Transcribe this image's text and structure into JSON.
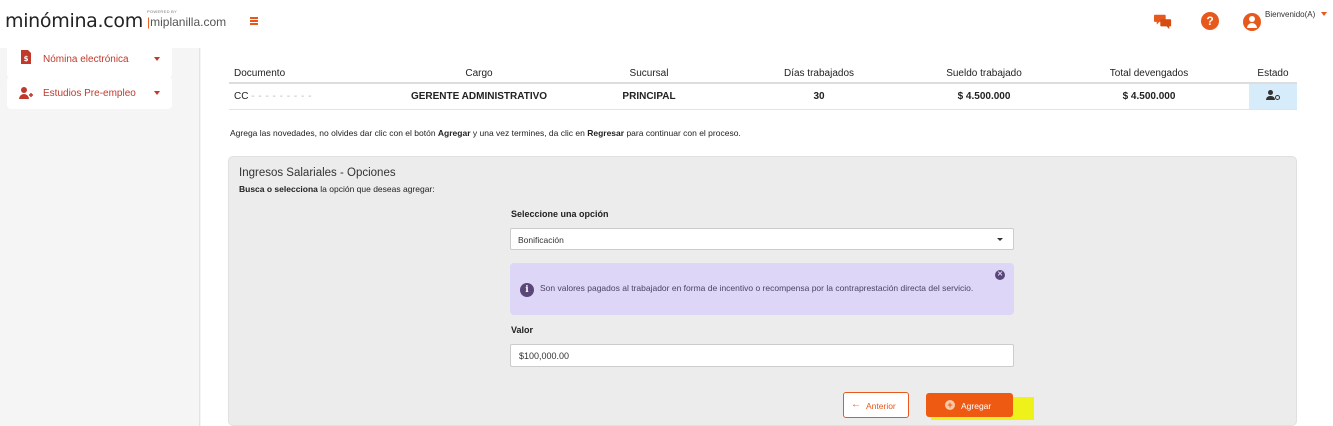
{
  "header": {
    "logo_text": "minómina.com",
    "powered_by": "POWERED BY",
    "sublogo": "miplanilla.com",
    "welcome": "Bienvenido(A)",
    "help_glyph": "?",
    "icons": [
      "menu-toggle-icon",
      "chat-icon",
      "help-icon",
      "user-icon"
    ],
    "accent_color": "#e8581c"
  },
  "sidebar": {
    "items": [
      {
        "label": "Nómina electrónica",
        "icon": "file-dollar-icon"
      },
      {
        "label": "Estudios Pre-empleo",
        "icon": "user-plus-icon"
      }
    ]
  },
  "table": {
    "headers": [
      "Documento",
      "Cargo",
      "Sucursal",
      "Días trabajados",
      "Sueldo trabajado",
      "Total devengados",
      "Estado"
    ],
    "row": {
      "documento_prefix": "CC",
      "documento_masked": "- - - - - - - - -",
      "cargo": "GERENTE ADMINISTRATIVO",
      "sucursal": "PRINCIPAL",
      "dias": "30",
      "sueldo": "$ 4.500.000",
      "total": "$ 4.500.000",
      "estado_icon": "user-settings-icon"
    }
  },
  "info": {
    "part1": "Agrega las novedades, no olvides dar clic con el botón ",
    "bold1": "Agregar",
    "part2": " y una vez termines, da clic en ",
    "bold2": "Regresar",
    "part3": " para continuar con el proceso."
  },
  "panel": {
    "title": "Ingresos Salariales - Opciones",
    "subtitle_bold": "Busca o selecciona",
    "subtitle_rest": " la opción que deseas agregar:",
    "select_label": "Seleccione una opción",
    "select_value": "Bonificación",
    "alert_text": "Son valores pagados al trabajador en forma de incentivo o recompensa por la contraprestación directa del servicio.",
    "alert_icon_glyph": "i",
    "alert_close_glyph": "✕",
    "valor_label": "Valor",
    "valor_value": "$100,000.00",
    "prev_button": "Anterior",
    "prev_arrow": "←",
    "add_button": "Agregar",
    "add_glyph": "+",
    "highlight_color": "#eef21a"
  }
}
